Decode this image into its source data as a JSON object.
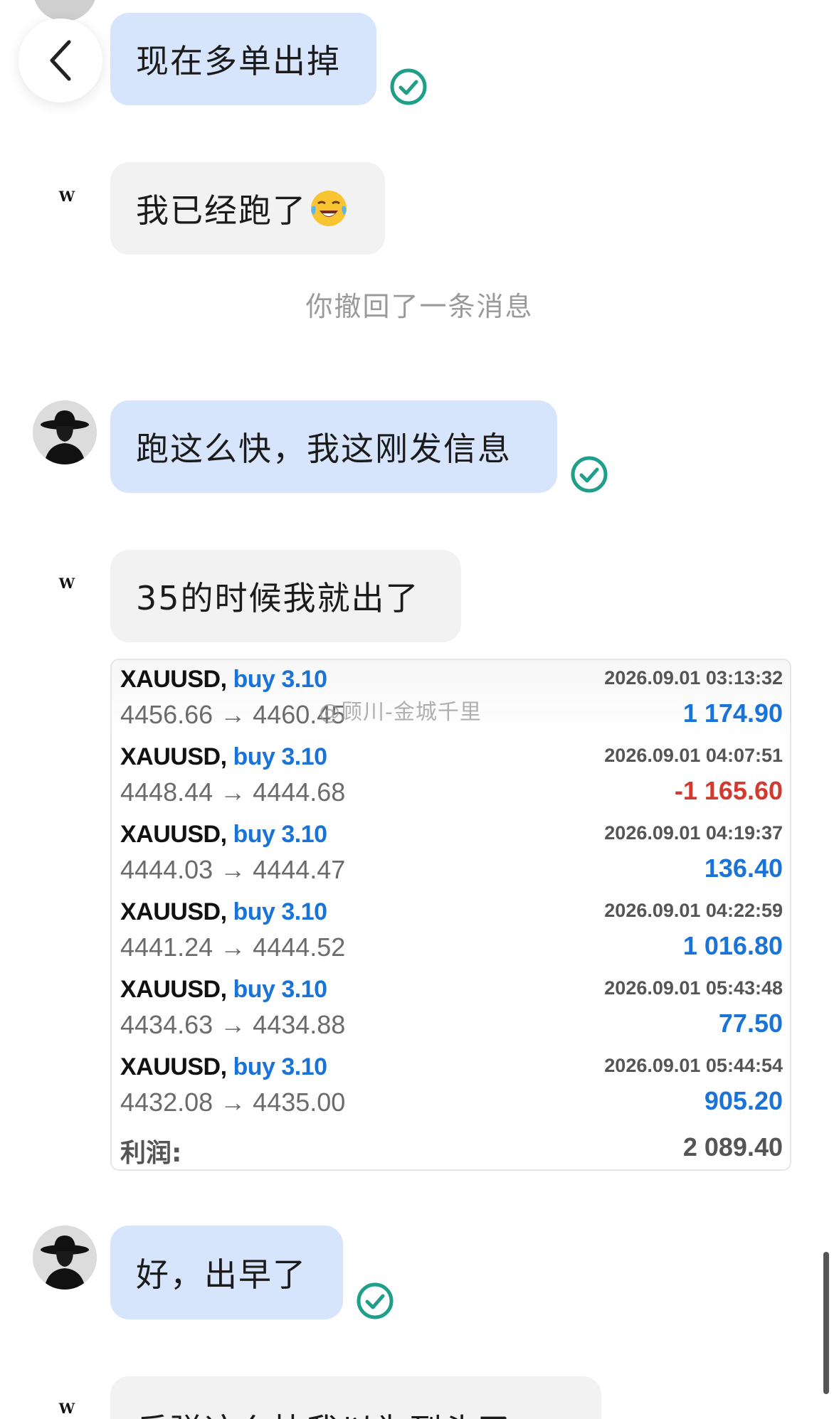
{
  "header": {
    "back_icon": "chevron-left-icon"
  },
  "messages": [
    {
      "side": "mine",
      "text": "现在多单出掉",
      "status": "read"
    },
    {
      "side": "theirs",
      "text": "我已经跑了",
      "emoji": "crying-laughing-face"
    },
    {
      "side": "mine",
      "text": "跑这么快，我这刚发信息",
      "status": "read"
    },
    {
      "side": "theirs",
      "text": "35的时候我就出了"
    },
    {
      "side": "mine",
      "text": "好，出早了",
      "status": "read"
    },
    {
      "side": "theirs",
      "text": "反弹这么快我以为到头了"
    }
  ],
  "system_notice": "你撤回了一条消息",
  "trades": [
    {
      "symbol": "XAUUSD,",
      "side": "buy 3.10",
      "open": "4456.66",
      "close": "4460.45",
      "arrow": "→",
      "time": "2026.09.01 03:13:32",
      "profit": "1 174.90",
      "profit_color": "#1a73d6"
    },
    {
      "symbol": "XAUUSD,",
      "side": "buy 3.10",
      "open": "4448.44",
      "close": "4444.68",
      "arrow": "→",
      "time": "2026.09.01 04:07:51",
      "profit": "-1 165.60",
      "profit_color": "#d23a2f"
    },
    {
      "symbol": "XAUUSD,",
      "side": "buy 3.10",
      "open": "4444.03",
      "close": "4444.47",
      "arrow": "→",
      "time": "2026.09.01 04:19:37",
      "profit": "136.40",
      "profit_color": "#1a73d6"
    },
    {
      "symbol": "XAUUSD,",
      "side": "buy 3.10",
      "open": "4441.24",
      "close": "4444.52",
      "arrow": "→",
      "time": "2026.09.01 04:22:59",
      "profit": "1 016.80",
      "profit_color": "#1a73d6"
    },
    {
      "symbol": "XAUUSD,",
      "side": "buy 3.10",
      "open": "4434.63",
      "close": "4434.88",
      "arrow": "→",
      "time": "2026.09.01 05:43:48",
      "profit": "77.50",
      "profit_color": "#1a73d6"
    },
    {
      "symbol": "XAUUSD,",
      "side": "buy 3.10",
      "open": "4432.08",
      "close": "4435.00",
      "arrow": "→",
      "time": "2026.09.01 05:44:54",
      "profit": "905.20",
      "profit_color": "#1a73d6"
    }
  ],
  "total": {
    "label": "利润:",
    "value": "2 089.40"
  },
  "watermark": "@顾川-金城千里",
  "colors": {
    "my_bubble": "#d7e5fc",
    "their_bubble": "#f2f2f2",
    "check": "#1f9e8a",
    "buy": "#1a73d6",
    "loss": "#d23a2f"
  }
}
